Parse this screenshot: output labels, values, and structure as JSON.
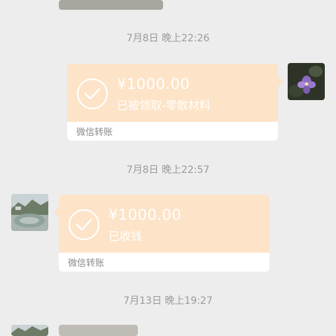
{
  "chat": {
    "messages": [
      {
        "timestamp": "7月8日 晚上22:26",
        "amount": "¥1000.00",
        "status": "已被领取-零散材料",
        "footer": "微信转账"
      },
      {
        "timestamp": "7月8日 晚上22:57",
        "amount": "¥1000.00",
        "status": "已收钱",
        "footer": "微信转账"
      },
      {
        "timestamp": "7月13日 晚上19:27"
      }
    ]
  },
  "colors": {
    "background": "#ededed",
    "card_top": "#fde3c7",
    "card_bottom": "#ffffff",
    "timestamp": "#9a9a9a",
    "footer_text": "#8b8b8b"
  }
}
